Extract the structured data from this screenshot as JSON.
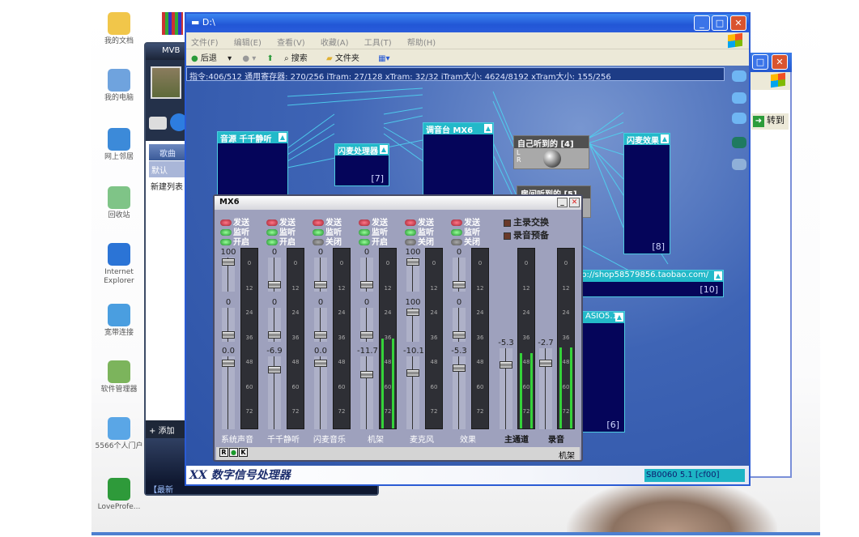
{
  "desktop_icons": [
    {
      "label": "我的文档",
      "color": "#f1c64a"
    },
    {
      "label": "我的电脑",
      "color": "#6fa3de"
    },
    {
      "label": "网上邻居",
      "color": "#3c8ad9"
    },
    {
      "label": "回收站",
      "color": "#7fc487"
    },
    {
      "label": "Internet Explorer",
      "color": "#2b74d6"
    },
    {
      "label": "宽带连接",
      "color": "#4a9ee0"
    },
    {
      "label": "软件管理器",
      "color": "#7cb45c"
    },
    {
      "label": "5566个人门户",
      "color": "#5aa6e6"
    },
    {
      "label": "LoveProfe...",
      "color": "#2e9a3a"
    }
  ],
  "mvb": {
    "title": "MVB",
    "tab": "歌曲",
    "selected": "默认",
    "list_item": "新建列表",
    "add": "+ 添加",
    "bottom": "【最新"
  },
  "explorer": {
    "title": "D:\\",
    "menu": [
      "文件(F)",
      "编辑(E)",
      "查看(V)",
      "收藏(A)",
      "工具(T)",
      "帮助(H)"
    ],
    "toolbar": {
      "back": "后退",
      "search": "搜索",
      "folders": "文件夹"
    }
  },
  "explorer2": {
    "goto": "转到"
  },
  "dsp": {
    "status": "指令:406/512 通用寄存器: 270/256 iTram: 27/128 xTram: 32/32 iTram大小: 4624/8192 xTram大小: 155/256",
    "nodes": {
      "source": {
        "title": "音源  千千静听"
      },
      "mic_proc": {
        "title": "闪麦处理器",
        "num": "[7]"
      },
      "mixer": {
        "title": "调音台  MX6"
      },
      "self_hear": {
        "title": "自己听到的 [4]",
        "l": "L",
        "r": "R"
      },
      "room_hear": {
        "title": "房间听到的 [5]"
      },
      "mic_fx": {
        "title": "闪麦效果",
        "num": "[8]"
      },
      "url": {
        "title": "http://shop58579856.taobao.com/",
        "num": "[10]"
      },
      "asio": {
        "title": "ASIO5.1",
        "num": "[6]"
      }
    },
    "brand": "XX 数字信号处理器",
    "device": "SB0060 5.1 [cf00]"
  },
  "mx6": {
    "title": "MX6",
    "led_labels": {
      "send": "发送",
      "monitor": "监听",
      "on": "开启",
      "off": "关闭"
    },
    "options": [
      "主录交换",
      "录音预备"
    ],
    "channels": [
      {
        "name": "系统声音",
        "on": true,
        "top": "100",
        "mid": "0",
        "gain": "0.0",
        "level": 0
      },
      {
        "name": "千千静听",
        "on": true,
        "top": "0",
        "mid": "0",
        "gain": "-6.9",
        "level": 0
      },
      {
        "name": "闪麦音乐",
        "on": false,
        "top": "0",
        "mid": "0",
        "gain": "0.0",
        "level": 0
      },
      {
        "name": "机架",
        "on": true,
        "top": "0",
        "mid": "0",
        "gain": "-11.7",
        "level": 0.5
      },
      {
        "name": "麦克风",
        "on": false,
        "top": "100",
        "mid": "100",
        "gain": "-10.1",
        "level": 0
      },
      {
        "name": "效果",
        "on": false,
        "top": "0",
        "mid": "0",
        "gain": "-5.3",
        "level": 0
      }
    ],
    "master": [
      {
        "name": "主通道",
        "gain": "-5.3",
        "level": 0.42
      },
      {
        "name": "录音",
        "gain": "-2.7",
        "level": 0.45
      }
    ],
    "meter_ticks": [
      "0",
      "12",
      "24",
      "36",
      "48",
      "60",
      "72"
    ],
    "footer": {
      "r": "R",
      "k": "K",
      "label": "机架"
    }
  }
}
